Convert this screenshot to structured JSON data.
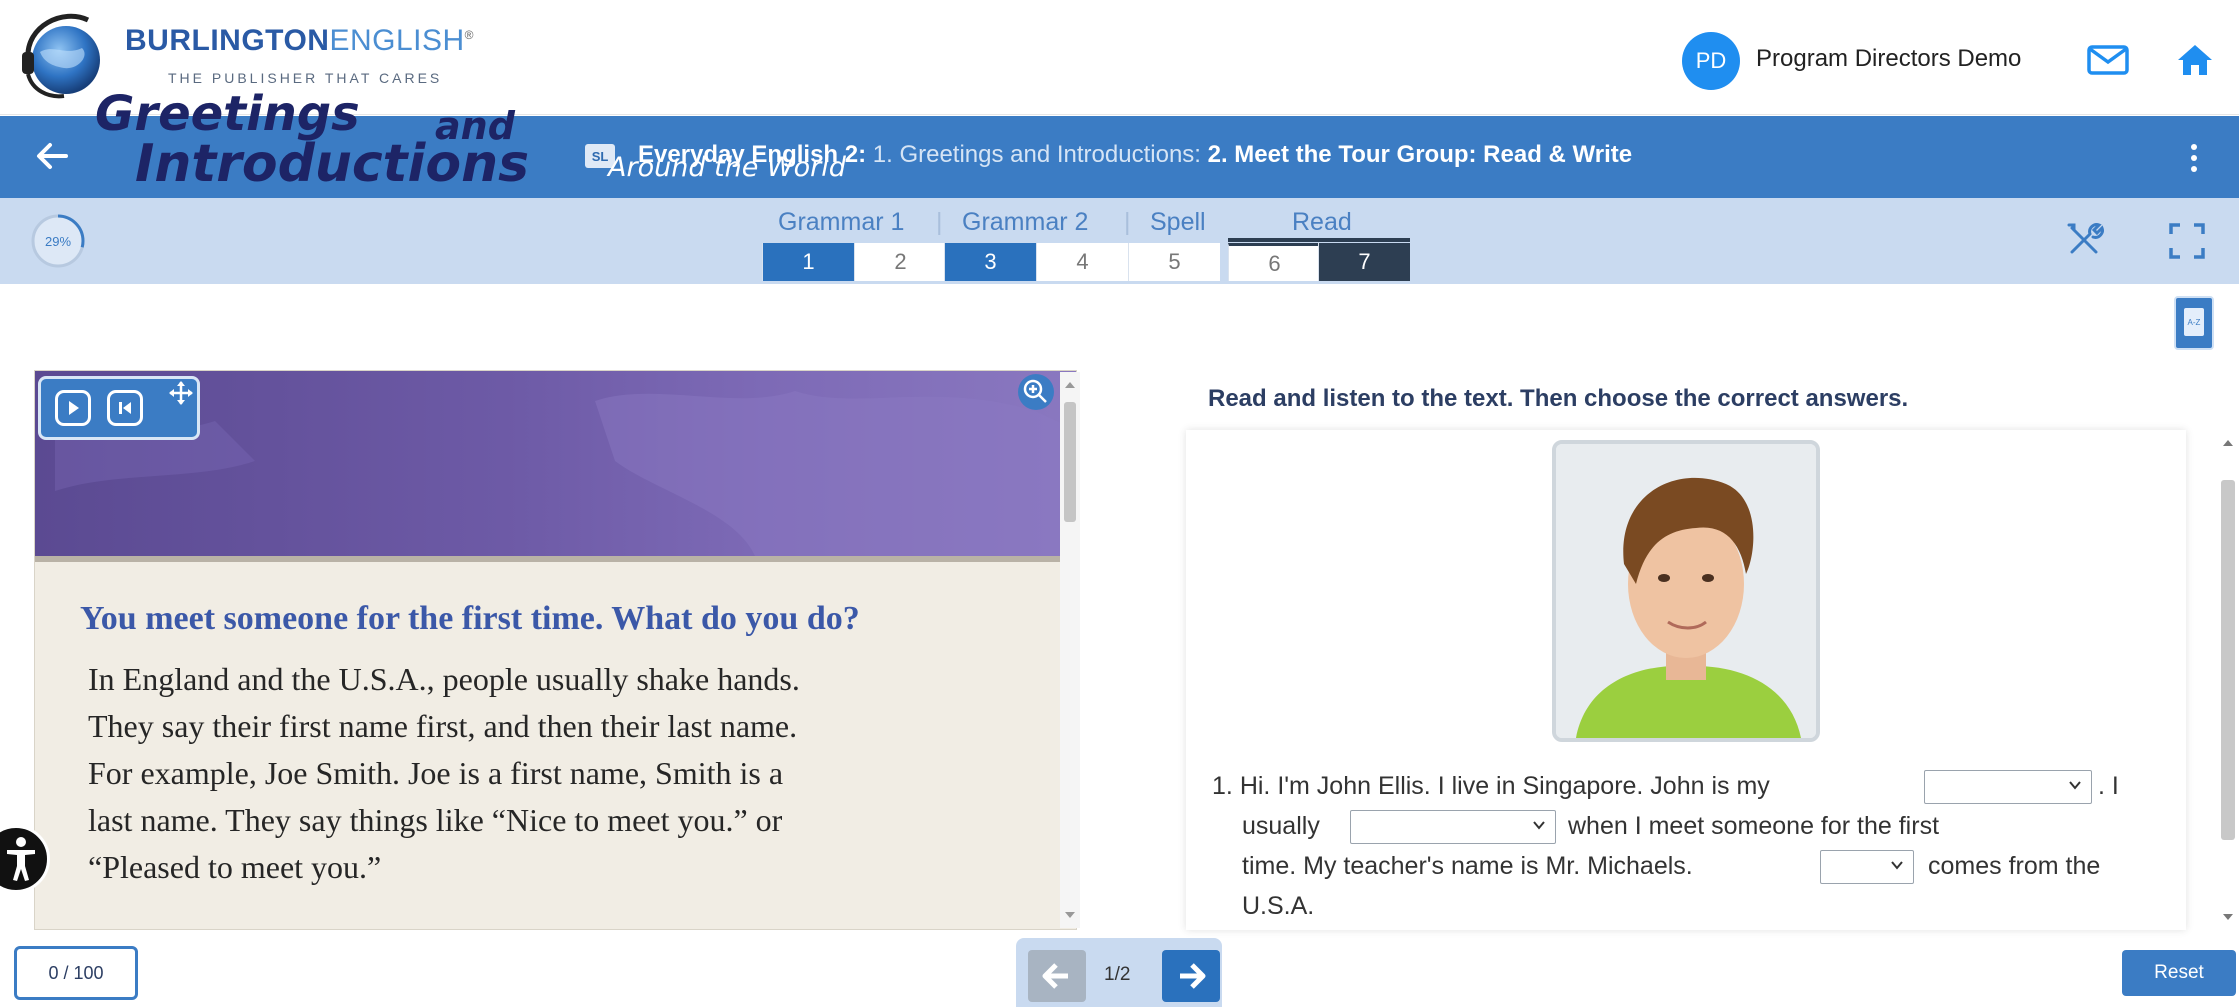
{
  "brand": {
    "name_bold": "BURLINGTON",
    "name_light": "ENGLISH",
    "registered": "®",
    "tagline": "THE PUBLISHER THAT CARES"
  },
  "user": {
    "initials": "PD",
    "name": "Program Directors Demo"
  },
  "header_icons": [
    "mail-icon",
    "home-icon"
  ],
  "titlebar": {
    "badge": "SL",
    "course": "Everyday English 2:",
    "unit": " 1. Greetings and Introductions: ",
    "lesson": "2. Meet the Tour Group: Read & Write"
  },
  "progress": {
    "percent_label": "29%",
    "value": 0.29
  },
  "step_groups": [
    {
      "label": "Grammar 1"
    },
    {
      "label": "Grammar 2"
    },
    {
      "label": "Spell"
    },
    {
      "label": "Read"
    }
  ],
  "steps": [
    {
      "num": "1",
      "state": "done"
    },
    {
      "num": "2",
      "state": "todo"
    },
    {
      "num": "3",
      "state": "done"
    },
    {
      "num": "4",
      "state": "todo"
    },
    {
      "num": "5",
      "state": "todo"
    },
    {
      "num": "6",
      "state": "todo"
    },
    {
      "num": "7",
      "state": "current"
    }
  ],
  "glossary_button": "A-Z",
  "reading": {
    "banner_title_1": "Greetings",
    "banner_and": "and",
    "banner_title_2": "Introductions",
    "banner_subtitle": "Around the World",
    "question": "You meet someone for the first time. What do you do?",
    "paragraph_lines": [
      "In England and the U.S.A., people usually shake hands.",
      "They say their first name first, and then their last name.",
      "For example, Joe Smith. Joe is a first name, Smith is a",
      "last name. They say things like “Nice to meet you.” or",
      "“Pleased to meet you.”"
    ]
  },
  "exercise": {
    "instruction": "Read and listen to the text. Then choose the correct answers.",
    "item_number": "1.",
    "seg1": "Hi. I'm John Ellis. I live in Singapore. John is my",
    "seg2": ". I",
    "seg3": "usually",
    "seg4": "when I meet someone for the first",
    "seg5": "time. My teacher's name is Mr. Michaels.",
    "seg6": "comes from the",
    "seg7": "U.S.A.",
    "dropdowns": [
      {
        "selected": ""
      },
      {
        "selected": ""
      },
      {
        "selected": ""
      }
    ]
  },
  "footer": {
    "score": "0 / 100",
    "page": "1/2",
    "reset": "Reset"
  },
  "colors": {
    "primary_blue": "#3b7cc4",
    "step_done": "#2a71bd",
    "step_current": "#2d3e52",
    "banner_purple": "#6d5aa6",
    "question_blue": "#3b58a8"
  }
}
